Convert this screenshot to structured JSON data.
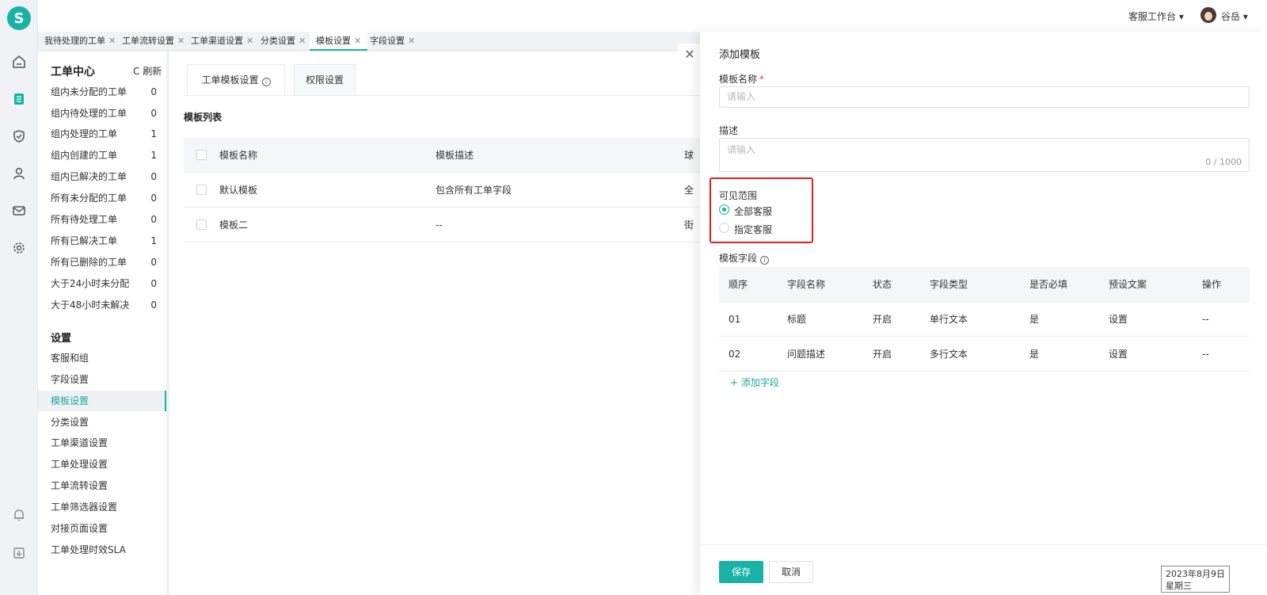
{
  "logo": "S",
  "topbar": {
    "workbench": "客服工作台 ▾",
    "user": "谷岳 ▾"
  },
  "tabs": [
    {
      "label": "我待处理的工单"
    },
    {
      "label": "工单流转设置"
    },
    {
      "label": "工单渠道设置"
    },
    {
      "label": "分类设置"
    },
    {
      "label": "模板设置"
    },
    {
      "label": "字段设置"
    }
  ],
  "tab_close": "✕",
  "sidebar": {
    "title": "工单中心",
    "refresh": "C 刷新",
    "items": [
      {
        "label": "组内未分配的工单",
        "count": "0"
      },
      {
        "label": "组内待处理的工单",
        "count": "0"
      },
      {
        "label": "组内处理的工单",
        "count": "1"
      },
      {
        "label": "组内创建的工单",
        "count": "1"
      },
      {
        "label": "组内已解决的工单",
        "count": "0"
      },
      {
        "label": "所有未分配的工单",
        "count": "0"
      },
      {
        "label": "所有待处理工单",
        "count": "0"
      },
      {
        "label": "所有已解决工单",
        "count": "1"
      },
      {
        "label": "所有已删除的工单",
        "count": "0"
      },
      {
        "label": "大于24小时未分配",
        "count": "0"
      },
      {
        "label": "大于48小时未解决",
        "count": "0"
      }
    ],
    "settings_title": "设置",
    "settings": [
      {
        "label": "客服和组"
      },
      {
        "label": "字段设置"
      },
      {
        "label": "模板设置"
      },
      {
        "label": "分类设置"
      },
      {
        "label": "工单渠道设置"
      },
      {
        "label": "工单处理设置"
      },
      {
        "label": "工单流转设置"
      },
      {
        "label": "工单筛选器设置"
      },
      {
        "label": "对接页面设置"
      },
      {
        "label": "工单处理时效SLA"
      }
    ]
  },
  "main": {
    "subtabs": [
      {
        "label": "工单模板设置"
      },
      {
        "label": "权限设置"
      }
    ],
    "list_title": "模板列表",
    "table": {
      "headers": [
        "模板名称",
        "模板描述",
        "球"
      ],
      "rows": [
        {
          "name": "默认模板",
          "desc": "包含所有工单字段",
          "extra": "全"
        },
        {
          "name": "模板二",
          "desc": "--",
          "extra": "街"
        }
      ]
    }
  },
  "drawer": {
    "title": "添加模板",
    "name_label": "模板名称",
    "required_mark": "*",
    "name_placeholder": "请输入",
    "desc_label": "描述",
    "desc_placeholder": "请输入",
    "desc_counter": "0 / 1000",
    "visibility_label": "可见范围",
    "visibility_options": [
      {
        "label": "全部客服",
        "checked": true
      },
      {
        "label": "指定客服",
        "checked": false
      }
    ],
    "fields_label": "模板字段",
    "fields_table": {
      "headers": [
        "顺序",
        "字段名称",
        "状态",
        "字段类型",
        "是否必填",
        "预设文案",
        "操作"
      ],
      "rows": [
        {
          "order": "01",
          "name": "标题",
          "status": "开启",
          "type": "单行文本",
          "required": "是",
          "preset": "设置",
          "op": "--"
        },
        {
          "order": "02",
          "name": "问题描述",
          "status": "开启",
          "type": "多行文本",
          "required": "是",
          "preset": "设置",
          "op": "--"
        }
      ]
    },
    "add_field": "+ 添加字段",
    "save": "保存",
    "cancel": "取消"
  },
  "close": "✕",
  "datetime": {
    "date": "2023年8月9日",
    "weekday": "星期三"
  },
  "colors": {
    "accent": "#18b3a5",
    "highlight": "#e02020"
  },
  "icons": [
    "home-icon",
    "ticket-icon",
    "shield-icon",
    "user-icon",
    "mail-icon",
    "gear-icon",
    "bell-icon",
    "download-icon"
  ]
}
